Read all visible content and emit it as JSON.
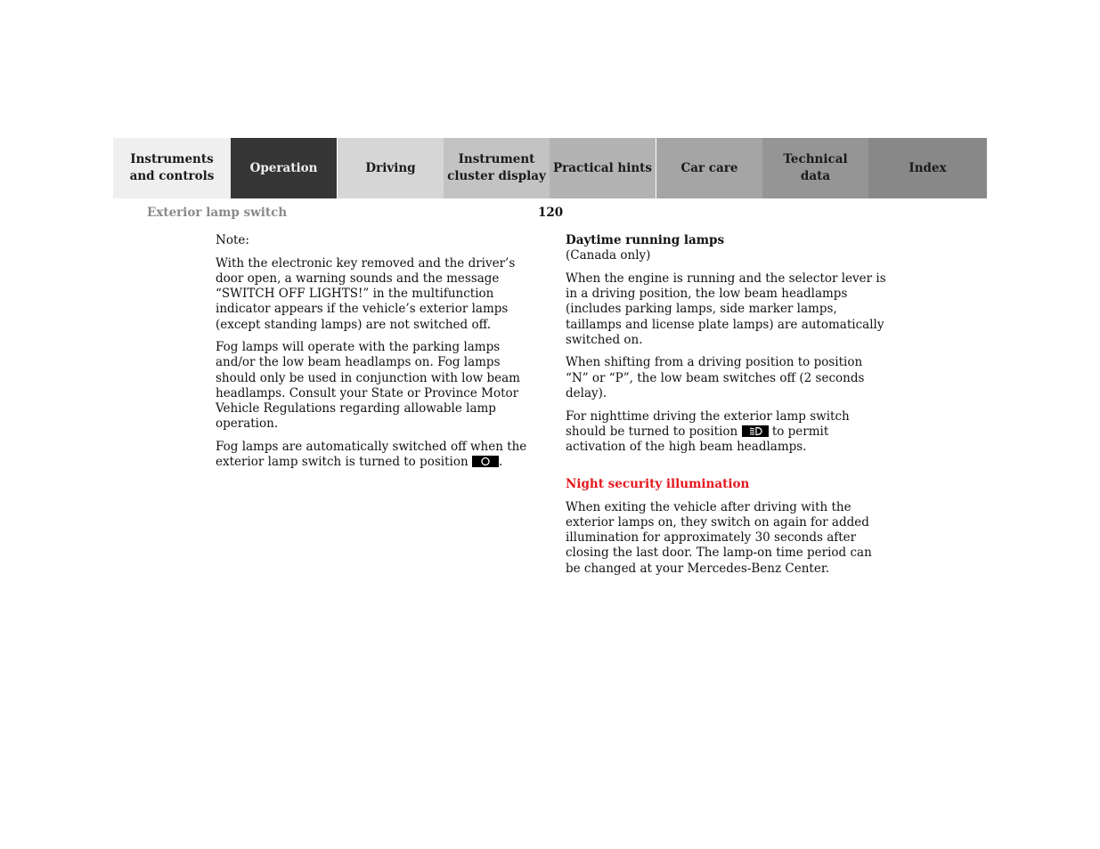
{
  "nav": {
    "tabs": [
      {
        "label": "Instruments\nand controls",
        "active": false
      },
      {
        "label": "Operation",
        "active": true
      },
      {
        "label": "Driving",
        "active": false
      },
      {
        "label": "Instrument\ncluster display",
        "active": false
      },
      {
        "label": "Practical hints",
        "active": false
      },
      {
        "label": "Car care",
        "active": false
      },
      {
        "label": "Technical\ndata",
        "active": false
      },
      {
        "label": "Index",
        "active": false
      }
    ]
  },
  "header": {
    "section_title": "Exterior lamp switch",
    "page_number": "120"
  },
  "left_column": {
    "note_label": "Note:",
    "para1": "With the electronic key removed and the driver’s door open, a warning sounds and the message “SWITCH OFF LIGHTS!” in the multifunction indicator appears if the vehicle’s exterior lamps (except standing lamps) are not switched off.",
    "para2": "Fog lamps will operate with the parking lamps and/or the low beam headlamps on. Fog lamps should only be used in conjunction with low beam headlamps. Consult your State or Province Motor Vehicle Regulations regarding allowable lamp operation.",
    "para3_before": "Fog lamps are automatically switched off when the exterior lamp switch is turned to position ",
    "para3_symbol": "off-position-icon",
    "para3_after": "."
  },
  "right_column": {
    "drl_heading": "Daytime running lamps",
    "drl_subheading": "(Canada only)",
    "para1": "When the engine is running and the selector lever is in a driving position, the low beam headlamps (includes parking lamps, side marker lamps, taillamps and license plate lamps) are automatically switched on.",
    "para2": "When shifting from a driving position to position “N” or “P”, the low beam switches off (2 seconds delay).",
    "para3_before": "For nighttime driving the exterior lamp switch should be turned to position ",
    "para3_symbol": "low-beam-headlamp-icon",
    "para3_after": " to permit activation of the high beam headlamps.",
    "night_heading": "Night security illumination",
    "night_heading_color": "#e3181f",
    "night_para": "When exiting the vehicle after driving with the exterior lamps on, they switch on again for added illumination for approximately 30 seconds after closing the last door. The lamp-on time period can be changed at your Mercedes-Benz Center."
  }
}
